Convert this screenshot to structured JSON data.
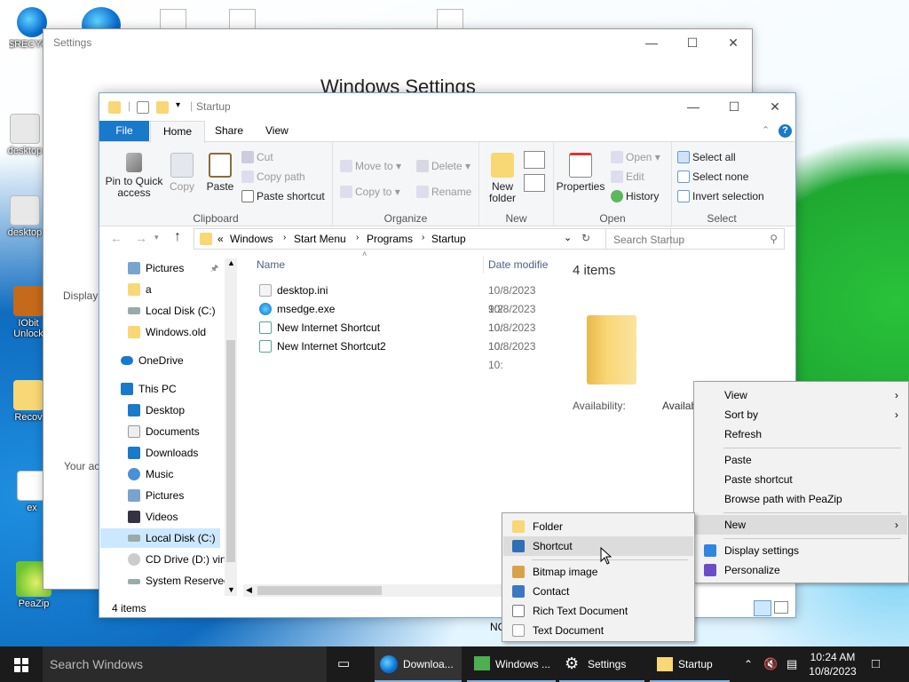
{
  "desktop": {
    "icons": [
      {
        "label": "$RECYCLE.BIN"
      },
      {
        "label": "desktop"
      },
      {
        "label": "desktop"
      },
      {
        "label": "IObit Unlock"
      },
      {
        "label": "Recov"
      },
      {
        "label": "ex"
      },
      {
        "label": "PeaZip"
      }
    ]
  },
  "settings": {
    "title": "Settings",
    "heading": "Windows Settings",
    "side_text_1": "Display",
    "side_text_2": "Your ac"
  },
  "explorer": {
    "title": "Startup",
    "tabs": [
      "File",
      "Home",
      "Share",
      "View"
    ],
    "clipboard": {
      "label": "Clipboard",
      "pin": "Pin to Quick access",
      "copy": "Copy",
      "paste": "Paste",
      "cut": "Cut",
      "copy_path": "Copy path",
      "paste_shortcut": "Paste shortcut"
    },
    "organize": {
      "label": "Organize",
      "move_to": "Move to",
      "copy_to": "Copy to",
      "delete": "Delete",
      "rename": "Rename"
    },
    "new": {
      "label": "New",
      "new_folder": "New folder"
    },
    "open": {
      "label": "Open",
      "properties": "Properties",
      "open": "Open",
      "edit": "Edit",
      "history": "History"
    },
    "select": {
      "label": "Select",
      "select_all": "Select all",
      "select_none": "Select none",
      "invert": "Invert selection"
    },
    "address": {
      "prefix": "«",
      "crumbs": [
        "Windows",
        "Start Menu",
        "Programs",
        "Startup"
      ]
    },
    "search_placeholder": "Search Startup",
    "nav": [
      "Pictures",
      "a",
      "Local Disk (C:)",
      "Windows.old",
      "OneDrive",
      "This PC",
      "Desktop",
      "Documents",
      "Downloads",
      "Music",
      "Pictures",
      "Videos",
      "Local Disk (C:)",
      "CD Drive (D:) virt",
      "System Reserved"
    ],
    "columns": {
      "name": "Name",
      "date": "Date modifie"
    },
    "files": [
      {
        "name": "desktop.ini",
        "date": "10/8/2023 9:2"
      },
      {
        "name": "msedge.exe",
        "date": "10/8/2023 10:"
      },
      {
        "name": "New Internet Shortcut",
        "date": "10/8/2023 10:"
      },
      {
        "name": "New Internet Shortcut2",
        "date": "10/8/2023 10:"
      }
    ],
    "details": {
      "count": "4 items",
      "availability_label": "Availability:",
      "availability_value": "Available off"
    },
    "status": "4 items",
    "behind_text": "NC"
  },
  "context_menu": {
    "items": [
      "View",
      "Sort by",
      "Refresh",
      "Paste",
      "Paste shortcut",
      "Browse path with PeaZip",
      "New",
      "Display settings",
      "Personalize"
    ]
  },
  "new_submenu": {
    "items": [
      "Folder",
      "Shortcut",
      "Bitmap image",
      "Contact",
      "Rich Text Document",
      "Text Document"
    ]
  },
  "taskbar": {
    "search": "Search Windows",
    "apps": [
      "Downloa...",
      "Windows ...",
      "Settings",
      "Startup"
    ],
    "time": "10:24 AM",
    "date": "10/8/2023"
  },
  "colors": {
    "accent": "#1979ca",
    "folder": "#f8d775",
    "taskbar": "#1b1b1b",
    "menu_highlight": "#dcdcdc"
  }
}
